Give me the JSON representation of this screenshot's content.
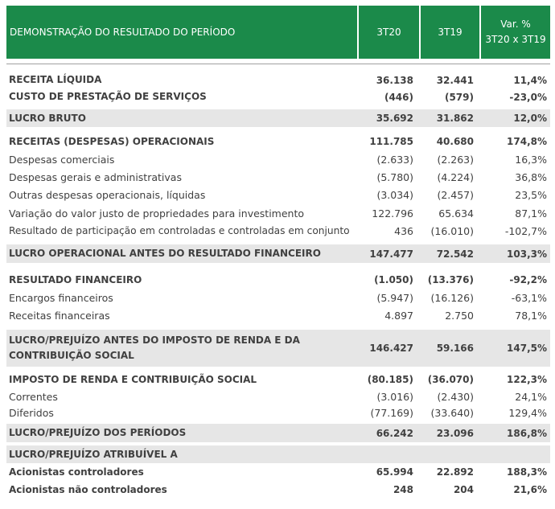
{
  "header": {
    "description": "DEMONSTRAÇÃO DO RESULTADO DO PERÍODO",
    "col1": "3T20",
    "col2": "3T19",
    "col3_line1": "Var. %",
    "col3_line2": "3T20 x 3T19"
  },
  "rows": [
    {
      "label": "RECEITA LÍQUIDA",
      "v1": "36.138",
      "v2": "32.441",
      "v3": "11,4%"
    },
    {
      "label": "CUSTO DE PRESTAÇÃO DE SERVIÇOS",
      "v1": "(446)",
      "v2": "(579)",
      "v3": "-23,0%"
    },
    {
      "label": "LUCRO BRUTO",
      "v1": "35.692",
      "v2": "31.862",
      "v3": "12,0%"
    },
    {
      "label": "RECEITAS (DESPESAS) OPERACIONAIS",
      "v1": "111.785",
      "v2": "40.680",
      "v3": "174,8%"
    },
    {
      "label": "Despesas comerciais",
      "v1": "(2.633)",
      "v2": "(2.263)",
      "v3": "16,3%"
    },
    {
      "label": "Despesas gerais e administrativas",
      "v1": "(5.780)",
      "v2": "(4.224)",
      "v3": "36,8%"
    },
    {
      "label": "Outras despesas operacionais, líquidas",
      "v1": "(3.034)",
      "v2": "(2.457)",
      "v3": "23,5%"
    },
    {
      "label": "Variação do valor justo de propriedades para investimento",
      "v1": "122.796",
      "v2": "65.634",
      "v3": "87,1%"
    },
    {
      "label": "Resultado de participação em controladas e controladas em conjunto",
      "v1": "436",
      "v2": "(16.010)",
      "v3": "-102,7%"
    },
    {
      "label": "LUCRO OPERACIONAL ANTES DO RESULTADO FINANCEIRO",
      "v1": "147.477",
      "v2": "72.542",
      "v3": "103,3%"
    },
    {
      "label": "RESULTADO FINANCEIRO",
      "v1": "(1.050)",
      "v2": "(13.376)",
      "v3": "-92,2%"
    },
    {
      "label": "Encargos financeiros",
      "v1": "(5.947)",
      "v2": "(16.126)",
      "v3": "-63,1%"
    },
    {
      "label": "Receitas financeiras",
      "v1": "4.897",
      "v2": "2.750",
      "v3": "78,1%"
    },
    {
      "label": "LUCRO/PREJUÍZO ANTES DO IMPOSTO DE RENDA E DA CONTRIBUIÇÃO SOCIAL",
      "v1": "146.427",
      "v2": "59.166",
      "v3": "147,5%"
    },
    {
      "label": "IMPOSTO DE RENDA E CONTRIBUIÇÃO SOCIAL",
      "v1": "(80.185)",
      "v2": "(36.070)",
      "v3": "122,3%"
    },
    {
      "label": "Correntes",
      "v1": "(3.016)",
      "v2": "(2.430)",
      "v3": "24,1%"
    },
    {
      "label": "Diferidos",
      "v1": "(77.169)",
      "v2": "(33.640)",
      "v3": "129,4%"
    },
    {
      "label": "LUCRO/PREJUÍZO DOS PERÍODOS",
      "v1": "66.242",
      "v2": "23.096",
      "v3": "186,8%"
    },
    {
      "label": "LUCRO/PREJUÍZO ATRIBUÍVEL A",
      "v1": "",
      "v2": "",
      "v3": ""
    },
    {
      "label": "Acionistas controladores",
      "v1": "65.994",
      "v2": "22.892",
      "v3": "188,3%"
    },
    {
      "label": "Acionistas não controladores",
      "v1": "248",
      "v2": "204",
      "v3": "21,6%"
    }
  ]
}
